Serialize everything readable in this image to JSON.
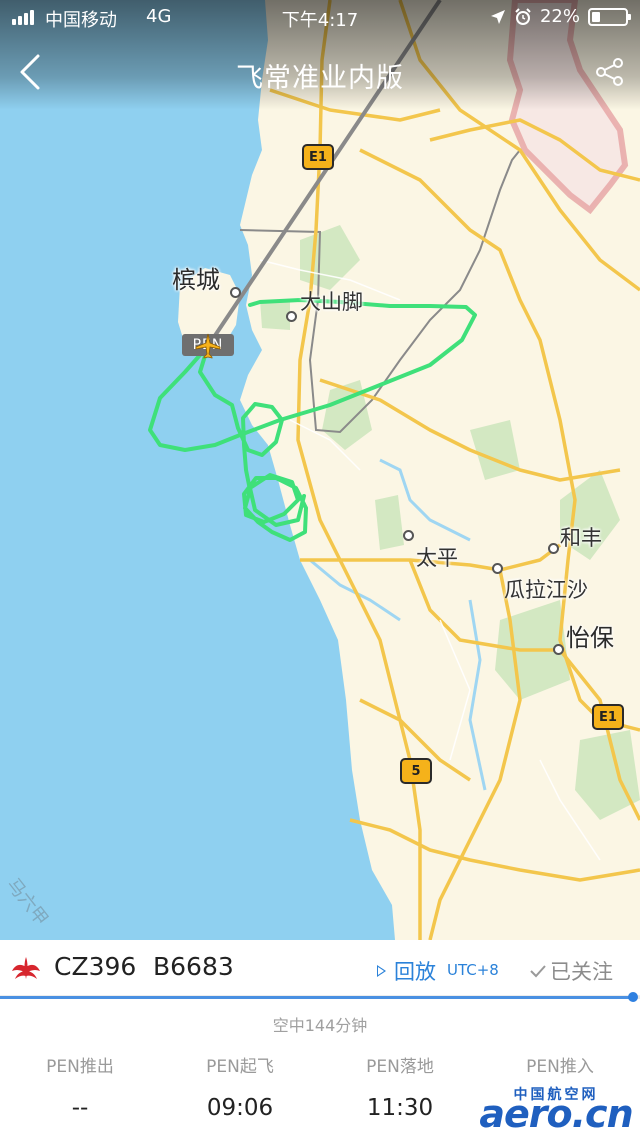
{
  "status_bar": {
    "carrier": "中国移动",
    "network": "4G",
    "time": "下午4:17",
    "battery_percent": "22%",
    "battery_level": 0.22,
    "signal_bars": 4
  },
  "nav": {
    "title": "飞常准业内版",
    "back_icon": "chevron-left-icon",
    "share_icon": "share-icon"
  },
  "map": {
    "cities": {
      "penang": "槟城",
      "sungai_petani": "大山脚",
      "taiping": "太平",
      "kuala_kangsar": "瓜拉江沙",
      "ipoh": "怡保",
      "hefeng": "和丰"
    },
    "airport_code": "PEN",
    "road_shields": [
      "E1",
      "E1",
      "5"
    ],
    "coast_text": "马六甲",
    "colors": {
      "water": "#8fd0f0",
      "land": "#fbf6e4",
      "road": "#f3c64c",
      "track": "#3fe07a",
      "border": "#e6a3a3"
    }
  },
  "flight": {
    "airline_logo_icon": "china-southern-logo-icon",
    "flight_number": "CZ396",
    "registration": "B6683",
    "replay_label": "回放",
    "timezone": "UTC+8",
    "follow_label": "已关注",
    "progress": 1.0,
    "air_time": "空中144分钟",
    "events": [
      {
        "label": "PEN推出",
        "value": "--"
      },
      {
        "label": "PEN起飞",
        "value": "09:06"
      },
      {
        "label": "PEN落地",
        "value": "11:30"
      },
      {
        "label": "PEN推入",
        "value": ""
      }
    ]
  },
  "watermark": {
    "cn": "中国航空网",
    "en": "aero.cn"
  }
}
